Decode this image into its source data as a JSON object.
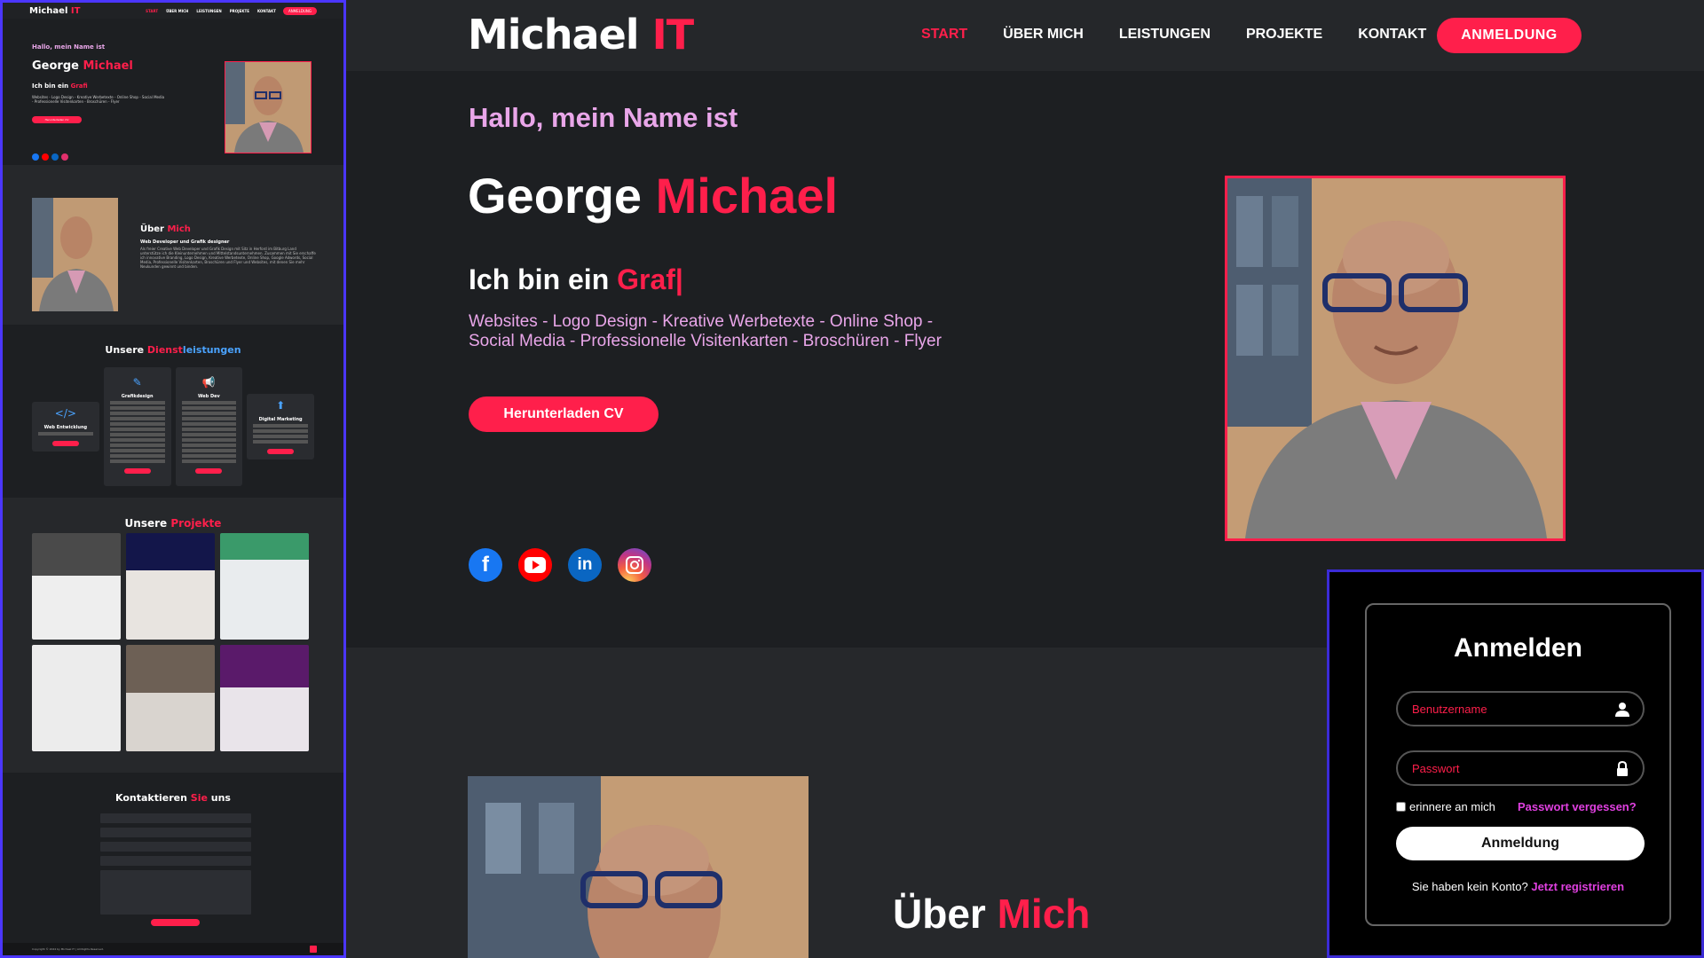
{
  "overview": {
    "logo_main": "Michael",
    "logo_accent": "IT",
    "nav": [
      "START",
      "ÜBER MICH",
      "LEISTUNGEN",
      "PROJEKTE",
      "KONTAKT"
    ],
    "nav_cta": "ANMELDUNG",
    "hello": "Hallo, mein Name ist",
    "name_first": "George",
    "name_last": "Michael",
    "iam": "Ich bin ein",
    "iam_word": "Grafi",
    "services_line": "Websites - Logo Design - Kreative Werbetexte - Online Shop - Social Media - Professionelle Visitenkarten - Broschüren - Flyer",
    "cv_button": "Herunterladen CV",
    "about_title_a": "Über",
    "about_title_b": "Mich",
    "about_role": "Web Developer und Grafik designer",
    "about_text": "Als freier Creative Web Developer und Grafik Design mit Sitz in Herford im Bitburg Land unterstütze ich die Kleinunternehmen und Mittelstandsunternehmen. Zusammen mit Sie erschaffe ich innovative Branding, Logo Design, Kreative Werbetexte, Online Shop, Google Adwords, Social Media, Professionelle Visitenkarten, Broschüren und Flyer und Websites, mit denen Sie mehr Neukunden gewinnt und binden.",
    "services_title_a": "Unsere",
    "services_title_b": "Dienst",
    "services_title_c": "leistungen",
    "services": [
      "Web Entwicklung",
      "Grafikdesign",
      "Web Dev",
      "Digital Marketing"
    ],
    "projects_title_a": "Unsere",
    "projects_title_b": "Projekte",
    "contact_title_a": "Kontaktieren",
    "contact_title_b": "Sie",
    "contact_title_c": "uns",
    "footer": "Copyright © 2024 by Michael IT | All Rights Reserved."
  },
  "main": {
    "logo_main": "Michael",
    "logo_accent": "IT",
    "nav": {
      "start": "START",
      "about": "ÜBER MICH",
      "services": "LEISTUNGEN",
      "projects": "PROJEKTE",
      "contact": "KONTAKT"
    },
    "nav_cta": "ANMELDUNG",
    "hello": "Hallo, mein Name ist",
    "name_first": "George",
    "name_last": "Michael",
    "iam": "Ich bin ein",
    "iam_word": "Graf|",
    "services_line": "Websites - Logo Design - Kreative Werbetexte - Online Shop - Social Media - Professionelle Visitenkarten - Broschüren - Flyer",
    "cv_button": "Herunterladen CV",
    "about_title_a": "Über",
    "about_title_b": "Mich"
  },
  "login": {
    "title": "Anmelden",
    "username_placeholder": "Benutzername",
    "password_placeholder": "Passwort",
    "remember": "erinnere an mich",
    "forgot": "Passwort vergessen?",
    "submit": "Anmeldung",
    "no_account": "Sie haben kein Konto?",
    "register": "Jetzt registrieren"
  },
  "colors": {
    "accent": "#ff1f4b",
    "pink": "#e9a6e9",
    "background": "#1d1f22",
    "section_alt": "#26282b",
    "overview_border": "#4b36ff",
    "login_border": "#3b2bd6",
    "link_magenta": "#e040e0"
  },
  "icons": [
    "facebook-icon",
    "youtube-icon",
    "linkedin-icon",
    "instagram-icon",
    "user-icon",
    "lock-icon"
  ]
}
